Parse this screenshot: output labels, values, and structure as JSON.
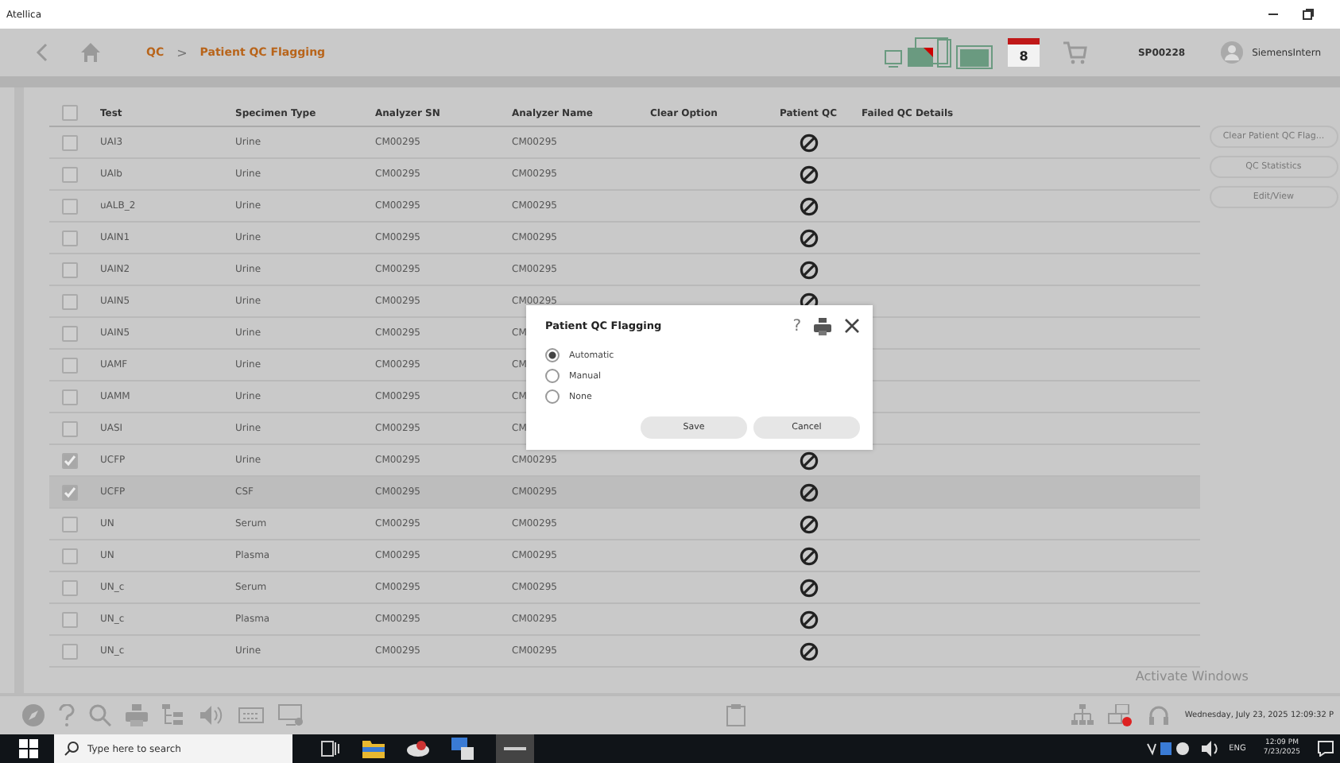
{
  "window": {
    "title": "Atellica"
  },
  "header": {
    "breadcrumb": [
      "QC",
      "Patient QC Flagging"
    ],
    "separator": ">",
    "calendar_day": "8",
    "sample_id": "SP00228",
    "user": "SiemensIntern"
  },
  "table": {
    "all_checked": false,
    "columns": [
      "Test",
      "Specimen Type",
      "Analyzer SN",
      "Analyzer Name",
      "Clear Option",
      "Patient QC",
      "Failed QC Details"
    ],
    "rows": [
      {
        "test": "UAI3",
        "specimen": "Urine",
        "sn": "CM00295",
        "name": "CM00295",
        "checked": false,
        "selected": false,
        "qc_blocked": true
      },
      {
        "test": "UAlb",
        "specimen": "Urine",
        "sn": "CM00295",
        "name": "CM00295",
        "checked": false,
        "selected": false,
        "qc_blocked": true
      },
      {
        "test": "uALB_2",
        "specimen": "Urine",
        "sn": "CM00295",
        "name": "CM00295",
        "checked": false,
        "selected": false,
        "qc_blocked": true
      },
      {
        "test": "UAIN1",
        "specimen": "Urine",
        "sn": "CM00295",
        "name": "CM00295",
        "checked": false,
        "selected": false,
        "qc_blocked": true
      },
      {
        "test": "UAIN2",
        "specimen": "Urine",
        "sn": "CM00295",
        "name": "CM00295",
        "checked": false,
        "selected": false,
        "qc_blocked": true
      },
      {
        "test": "UAIN5",
        "specimen": "Urine",
        "sn": "CM00295",
        "name": "CM00295",
        "checked": false,
        "selected": false,
        "qc_blocked": true
      },
      {
        "test": "UAIN5",
        "specimen": "Urine",
        "sn": "CM00295",
        "name": "CM",
        "checked": false,
        "selected": false
      },
      {
        "test": "UAMF",
        "specimen": "Urine",
        "sn": "CM00295",
        "name": "CM",
        "checked": false,
        "selected": false
      },
      {
        "test": "UAMM",
        "specimen": "Urine",
        "sn": "CM00295",
        "name": "CM",
        "checked": false,
        "selected": false
      },
      {
        "test": "UASI",
        "specimen": "Urine",
        "sn": "CM00295",
        "name": "CM",
        "checked": false,
        "selected": false
      },
      {
        "test": "UCFP",
        "specimen": "Urine",
        "sn": "CM00295",
        "name": "CM00295",
        "checked": true,
        "selected": false,
        "qc_blocked": true
      },
      {
        "test": "UCFP",
        "specimen": "CSF",
        "sn": "CM00295",
        "name": "CM00295",
        "checked": true,
        "selected": true,
        "qc_blocked": true
      },
      {
        "test": "UN",
        "specimen": "Serum",
        "sn": "CM00295",
        "name": "CM00295",
        "checked": false,
        "selected": false,
        "qc_blocked": true
      },
      {
        "test": "UN",
        "specimen": "Plasma",
        "sn": "CM00295",
        "name": "CM00295",
        "checked": false,
        "selected": false,
        "qc_blocked": true
      },
      {
        "test": "UN_c",
        "specimen": "Serum",
        "sn": "CM00295",
        "name": "CM00295",
        "checked": false,
        "selected": false,
        "qc_blocked": true
      },
      {
        "test": "UN_c",
        "specimen": "Plasma",
        "sn": "CM00295",
        "name": "CM00295",
        "checked": false,
        "selected": false,
        "qc_blocked": true
      },
      {
        "test": "UN_c",
        "specimen": "Urine",
        "sn": "CM00295",
        "name": "CM00295",
        "checked": false,
        "selected": false,
        "qc_blocked": true
      }
    ]
  },
  "side_buttons": [
    {
      "label": "Clear Patient QC Flag...",
      "disabled": true
    },
    {
      "label": "QC Statistics",
      "disabled": true
    },
    {
      "label": "Edit/View",
      "disabled": true
    }
  ],
  "dialog": {
    "title": "Patient QC Flagging",
    "help": "?",
    "options": [
      {
        "label": "Automatic",
        "selected": true
      },
      {
        "label": "Manual",
        "selected": false
      },
      {
        "label": "None",
        "selected": false
      }
    ],
    "buttons": [
      "Save",
      "Cancel"
    ]
  },
  "status": {
    "datetime": "Wednesday, July 23, 2025 12:09:32 P",
    "activation": "Activate Windows"
  },
  "taskbar": {
    "search_placeholder": "Type here to search",
    "lang": "ENG",
    "time": "12:09 PM",
    "date": "7/23/2025"
  }
}
